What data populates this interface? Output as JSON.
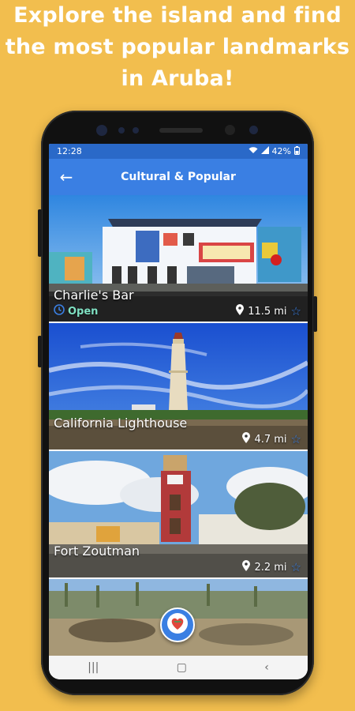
{
  "headline": {
    "line1": "Explore the island and find",
    "line2": "the most popular landmarks",
    "line3": "in Aruba!"
  },
  "status": {
    "time": "12:28",
    "battery": "42%"
  },
  "appbar": {
    "title": "Cultural & Popular"
  },
  "places": [
    {
      "name": "Charlie's Bar",
      "status": "Open",
      "distance": "11.5 mi"
    },
    {
      "name": "California Lighthouse",
      "distance": "4.7 mi"
    },
    {
      "name": "Fort Zoutman",
      "distance": "2.2 mi"
    }
  ],
  "colors": {
    "background": "#F2BE4E",
    "appbar": "#3A7FE3",
    "statusbar": "#2A69C8",
    "open": "#7fe0c2"
  },
  "icons": [
    "back-arrow-icon",
    "wifi-icon",
    "signal-icon",
    "battery-icon",
    "clock-icon",
    "location-pin-icon",
    "star-outline-icon",
    "heart-logo-icon",
    "nav-recents-icon",
    "nav-home-icon",
    "nav-back-icon"
  ]
}
